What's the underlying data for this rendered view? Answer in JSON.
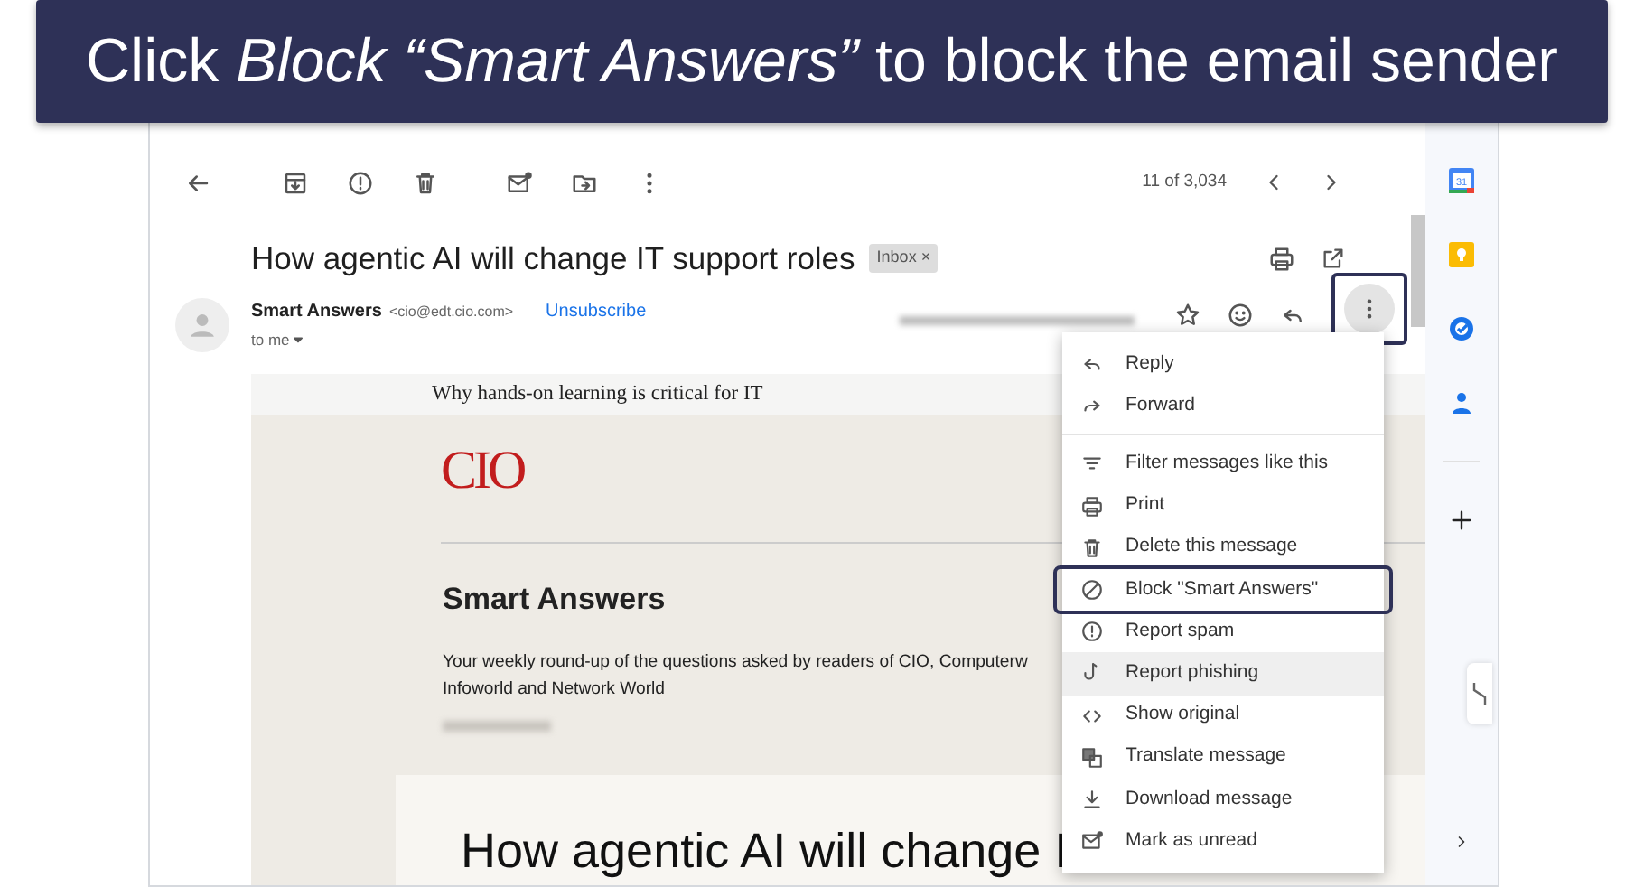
{
  "banner": {
    "text": "Click *Block “Smart Answers”* to block the email sender"
  },
  "toolbar": {
    "counter": "11 of 3,034"
  },
  "subject": {
    "title": "How agentic AI will change IT support roles",
    "label": "Inbox",
    "label_close": "×"
  },
  "sender": {
    "name": "Smart Answers",
    "email": "<cio@edt.cio.com>",
    "unsubscribe": "Unsubscribe",
    "recipient": "to me",
    "more_button_outlined": true
  },
  "email_body": {
    "preheader": "Why hands-on learning is critical for IT",
    "logo": "CIO",
    "heading": "Smart Answers",
    "intro_lines": [
      "Your weekly round-up of the questions asked by readers of CIO, Computerw",
      "Infoworld and Network World"
    ],
    "headline": "How agentic AI will change I"
  },
  "menu": {
    "items": [
      {
        "label": "Reply",
        "divider_before": false,
        "hovered": false,
        "outlined": false
      },
      {
        "label": "Forward",
        "divider_before": false,
        "hovered": false,
        "outlined": false
      },
      {
        "label": "Filter messages like this",
        "divider_before": true,
        "hovered": false,
        "outlined": false
      },
      {
        "label": "Print",
        "divider_before": false,
        "hovered": false,
        "outlined": false
      },
      {
        "label": "Delete this message",
        "divider_before": false,
        "hovered": false,
        "outlined": false
      },
      {
        "label": "Block \"Smart Answers\"",
        "divider_before": false,
        "hovered": false,
        "outlined": true
      },
      {
        "label": "Report spam",
        "divider_before": false,
        "hovered": false,
        "outlined": false
      },
      {
        "label": "Report phishing",
        "divider_before": false,
        "hovered": true,
        "outlined": false
      },
      {
        "label": "Show original",
        "divider_before": false,
        "hovered": false,
        "outlined": false
      },
      {
        "label": "Translate message",
        "divider_before": false,
        "hovered": false,
        "outlined": false
      },
      {
        "label": "Download message",
        "divider_before": false,
        "hovered": false,
        "outlined": false
      },
      {
        "label": "Mark as unread",
        "divider_before": false,
        "hovered": false,
        "outlined": false
      }
    ]
  },
  "side_panel": {
    "calendar_day": "31"
  }
}
